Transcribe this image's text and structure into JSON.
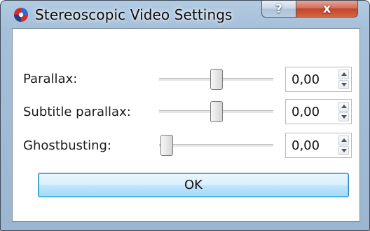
{
  "window": {
    "title": "Stereoscopic Video Settings",
    "icon": "app-logo-icon",
    "help_symbol": "?",
    "close_symbol": "x"
  },
  "settings": [
    {
      "key": "parallax",
      "label": "Parallax:",
      "value": "0,00",
      "slider_fraction": 0.5
    },
    {
      "key": "subtitle-parallax",
      "label": "Subtitle parallax:",
      "value": "0,00",
      "slider_fraction": 0.5
    },
    {
      "key": "ghostbusting",
      "label": "Ghostbusting:",
      "value": "0,00",
      "slider_fraction": 0.0
    }
  ],
  "ok_button": {
    "label": "OK"
  },
  "colors": {
    "frame": "#a6c0da",
    "close_button": "#c4452c",
    "ok_border": "#3c7fb1"
  }
}
